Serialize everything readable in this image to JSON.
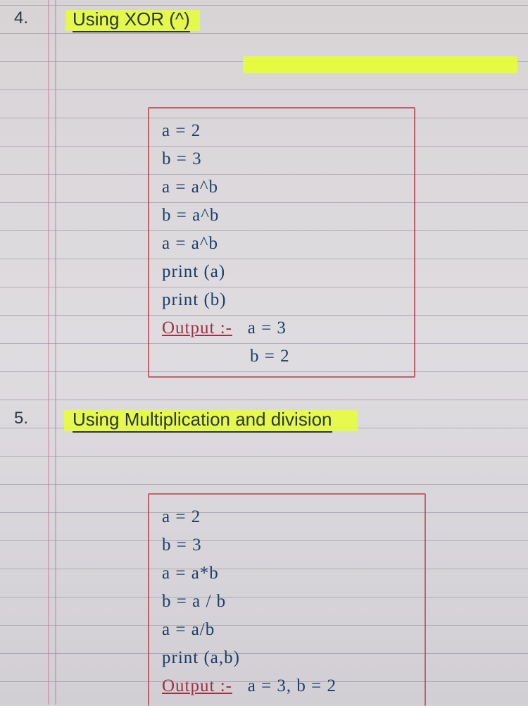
{
  "section1": {
    "number": "4.",
    "heading": "Using XOR (^)",
    "code": {
      "line1": "a = 2",
      "line2": "b = 3",
      "line3": "a = a^b",
      "line4": "b = a^b",
      "line5": "a = a^b",
      "line6": "print (a)",
      "line7": "print (b)",
      "output_label": "Output :-",
      "output_a": "a = 3",
      "output_b": "b = 2"
    }
  },
  "section2": {
    "number": "5.",
    "heading": "Using Multiplication and division",
    "code": {
      "line1": "a = 2",
      "line2": "b = 3",
      "line3": "a = a*b",
      "line4": "b = a / b",
      "line5": "a = a/b",
      "line6": "print (a,b)",
      "output_label": "Output :-",
      "output": "a = 3, b = 2"
    }
  }
}
